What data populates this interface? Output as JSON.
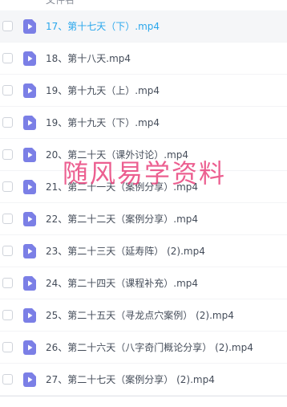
{
  "header": {
    "partial_text": "文件名"
  },
  "files": [
    {
      "name": "17、第十七天（下）.mp4",
      "selected": true
    },
    {
      "name": "18、第十八天.mp4",
      "selected": false
    },
    {
      "name": "19、第十九天（上）.mp4",
      "selected": false
    },
    {
      "name": "19、第十九天（下）.mp4",
      "selected": false
    },
    {
      "name": "20、第二十天（课外讨论）.mp4",
      "selected": false
    },
    {
      "name": "21、第二十一天（案例分享）.mp4",
      "selected": false
    },
    {
      "name": "22、第二十二天（案例分享）.mp4",
      "selected": false
    },
    {
      "name": "23、第二十三天（延寿阵） (2).mp4",
      "selected": false
    },
    {
      "name": "24、第二十四天（课程补充）.mp4",
      "selected": false
    },
    {
      "name": "25、第二十五天（寻龙点穴案例） (2).mp4",
      "selected": false
    },
    {
      "name": "26、第二十六天（八字奇门概论分享） (2).mp4",
      "selected": false
    },
    {
      "name": "27、第二十七天（案例分享） (2).mp4",
      "selected": false
    }
  ],
  "watermark": {
    "text": "随风易学资料"
  },
  "colors": {
    "selected_text": "#2aa7ec",
    "icon_fill": "#7b7fe6",
    "watermark": "#e83c78"
  },
  "icons": {
    "file": "video-file-icon"
  }
}
